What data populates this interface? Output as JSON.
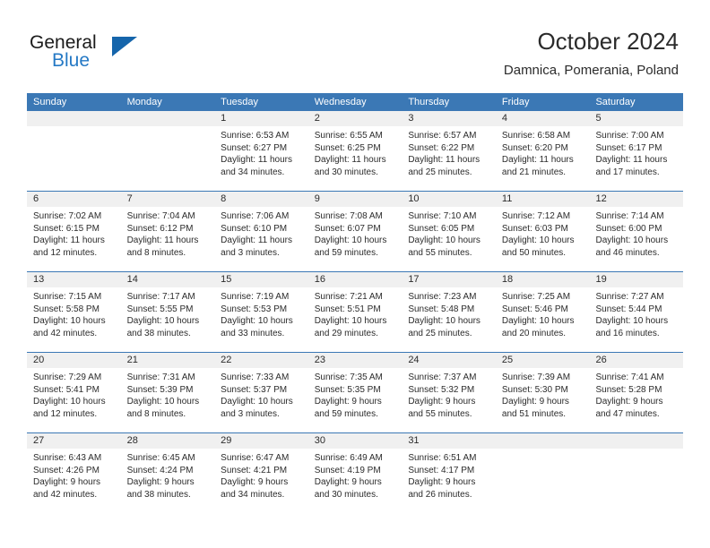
{
  "brand": {
    "name_part1": "General",
    "name_part2": "Blue",
    "triangle_color": "#1565ab",
    "blue_color": "#2579c5"
  },
  "header": {
    "title": "October 2024",
    "subtitle": "Damnica, Pomerania, Poland"
  },
  "theme": {
    "header_blue": "#3b78b5",
    "day_band_gray": "#f0f0f0",
    "text_color": "#2b2b2b"
  },
  "weekday_headers": [
    "Sunday",
    "Monday",
    "Tuesday",
    "Wednesday",
    "Thursday",
    "Friday",
    "Saturday"
  ],
  "weeks": [
    [
      {
        "day": "",
        "empty": true,
        "sunrise": "",
        "sunset": "",
        "daylight_line1": "",
        "daylight_line2": ""
      },
      {
        "day": "",
        "empty": true,
        "sunrise": "",
        "sunset": "",
        "daylight_line1": "",
        "daylight_line2": ""
      },
      {
        "day": "1",
        "sunrise": "Sunrise: 6:53 AM",
        "sunset": "Sunset: 6:27 PM",
        "daylight_line1": "Daylight: 11 hours",
        "daylight_line2": "and 34 minutes."
      },
      {
        "day": "2",
        "sunrise": "Sunrise: 6:55 AM",
        "sunset": "Sunset: 6:25 PM",
        "daylight_line1": "Daylight: 11 hours",
        "daylight_line2": "and 30 minutes."
      },
      {
        "day": "3",
        "sunrise": "Sunrise: 6:57 AM",
        "sunset": "Sunset: 6:22 PM",
        "daylight_line1": "Daylight: 11 hours",
        "daylight_line2": "and 25 minutes."
      },
      {
        "day": "4",
        "sunrise": "Sunrise: 6:58 AM",
        "sunset": "Sunset: 6:20 PM",
        "daylight_line1": "Daylight: 11 hours",
        "daylight_line2": "and 21 minutes."
      },
      {
        "day": "5",
        "sunrise": "Sunrise: 7:00 AM",
        "sunset": "Sunset: 6:17 PM",
        "daylight_line1": "Daylight: 11 hours",
        "daylight_line2": "and 17 minutes."
      }
    ],
    [
      {
        "day": "6",
        "sunrise": "Sunrise: 7:02 AM",
        "sunset": "Sunset: 6:15 PM",
        "daylight_line1": "Daylight: 11 hours",
        "daylight_line2": "and 12 minutes."
      },
      {
        "day": "7",
        "sunrise": "Sunrise: 7:04 AM",
        "sunset": "Sunset: 6:12 PM",
        "daylight_line1": "Daylight: 11 hours",
        "daylight_line2": "and 8 minutes."
      },
      {
        "day": "8",
        "sunrise": "Sunrise: 7:06 AM",
        "sunset": "Sunset: 6:10 PM",
        "daylight_line1": "Daylight: 11 hours",
        "daylight_line2": "and 3 minutes."
      },
      {
        "day": "9",
        "sunrise": "Sunrise: 7:08 AM",
        "sunset": "Sunset: 6:07 PM",
        "daylight_line1": "Daylight: 10 hours",
        "daylight_line2": "and 59 minutes."
      },
      {
        "day": "10",
        "sunrise": "Sunrise: 7:10 AM",
        "sunset": "Sunset: 6:05 PM",
        "daylight_line1": "Daylight: 10 hours",
        "daylight_line2": "and 55 minutes."
      },
      {
        "day": "11",
        "sunrise": "Sunrise: 7:12 AM",
        "sunset": "Sunset: 6:03 PM",
        "daylight_line1": "Daylight: 10 hours",
        "daylight_line2": "and 50 minutes."
      },
      {
        "day": "12",
        "sunrise": "Sunrise: 7:14 AM",
        "sunset": "Sunset: 6:00 PM",
        "daylight_line1": "Daylight: 10 hours",
        "daylight_line2": "and 46 minutes."
      }
    ],
    [
      {
        "day": "13",
        "sunrise": "Sunrise: 7:15 AM",
        "sunset": "Sunset: 5:58 PM",
        "daylight_line1": "Daylight: 10 hours",
        "daylight_line2": "and 42 minutes."
      },
      {
        "day": "14",
        "sunrise": "Sunrise: 7:17 AM",
        "sunset": "Sunset: 5:55 PM",
        "daylight_line1": "Daylight: 10 hours",
        "daylight_line2": "and 38 minutes."
      },
      {
        "day": "15",
        "sunrise": "Sunrise: 7:19 AM",
        "sunset": "Sunset: 5:53 PM",
        "daylight_line1": "Daylight: 10 hours",
        "daylight_line2": "and 33 minutes."
      },
      {
        "day": "16",
        "sunrise": "Sunrise: 7:21 AM",
        "sunset": "Sunset: 5:51 PM",
        "daylight_line1": "Daylight: 10 hours",
        "daylight_line2": "and 29 minutes."
      },
      {
        "day": "17",
        "sunrise": "Sunrise: 7:23 AM",
        "sunset": "Sunset: 5:48 PM",
        "daylight_line1": "Daylight: 10 hours",
        "daylight_line2": "and 25 minutes."
      },
      {
        "day": "18",
        "sunrise": "Sunrise: 7:25 AM",
        "sunset": "Sunset: 5:46 PM",
        "daylight_line1": "Daylight: 10 hours",
        "daylight_line2": "and 20 minutes."
      },
      {
        "day": "19",
        "sunrise": "Sunrise: 7:27 AM",
        "sunset": "Sunset: 5:44 PM",
        "daylight_line1": "Daylight: 10 hours",
        "daylight_line2": "and 16 minutes."
      }
    ],
    [
      {
        "day": "20",
        "sunrise": "Sunrise: 7:29 AM",
        "sunset": "Sunset: 5:41 PM",
        "daylight_line1": "Daylight: 10 hours",
        "daylight_line2": "and 12 minutes."
      },
      {
        "day": "21",
        "sunrise": "Sunrise: 7:31 AM",
        "sunset": "Sunset: 5:39 PM",
        "daylight_line1": "Daylight: 10 hours",
        "daylight_line2": "and 8 minutes."
      },
      {
        "day": "22",
        "sunrise": "Sunrise: 7:33 AM",
        "sunset": "Sunset: 5:37 PM",
        "daylight_line1": "Daylight: 10 hours",
        "daylight_line2": "and 3 minutes."
      },
      {
        "day": "23",
        "sunrise": "Sunrise: 7:35 AM",
        "sunset": "Sunset: 5:35 PM",
        "daylight_line1": "Daylight: 9 hours",
        "daylight_line2": "and 59 minutes."
      },
      {
        "day": "24",
        "sunrise": "Sunrise: 7:37 AM",
        "sunset": "Sunset: 5:32 PM",
        "daylight_line1": "Daylight: 9 hours",
        "daylight_line2": "and 55 minutes."
      },
      {
        "day": "25",
        "sunrise": "Sunrise: 7:39 AM",
        "sunset": "Sunset: 5:30 PM",
        "daylight_line1": "Daylight: 9 hours",
        "daylight_line2": "and 51 minutes."
      },
      {
        "day": "26",
        "sunrise": "Sunrise: 7:41 AM",
        "sunset": "Sunset: 5:28 PM",
        "daylight_line1": "Daylight: 9 hours",
        "daylight_line2": "and 47 minutes."
      }
    ],
    [
      {
        "day": "27",
        "sunrise": "Sunrise: 6:43 AM",
        "sunset": "Sunset: 4:26 PM",
        "daylight_line1": "Daylight: 9 hours",
        "daylight_line2": "and 42 minutes."
      },
      {
        "day": "28",
        "sunrise": "Sunrise: 6:45 AM",
        "sunset": "Sunset: 4:24 PM",
        "daylight_line1": "Daylight: 9 hours",
        "daylight_line2": "and 38 minutes."
      },
      {
        "day": "29",
        "sunrise": "Sunrise: 6:47 AM",
        "sunset": "Sunset: 4:21 PM",
        "daylight_line1": "Daylight: 9 hours",
        "daylight_line2": "and 34 minutes."
      },
      {
        "day": "30",
        "sunrise": "Sunrise: 6:49 AM",
        "sunset": "Sunset: 4:19 PM",
        "daylight_line1": "Daylight: 9 hours",
        "daylight_line2": "and 30 minutes."
      },
      {
        "day": "31",
        "sunrise": "Sunrise: 6:51 AM",
        "sunset": "Sunset: 4:17 PM",
        "daylight_line1": "Daylight: 9 hours",
        "daylight_line2": "and 26 minutes."
      },
      {
        "day": "",
        "empty": true,
        "sunrise": "",
        "sunset": "",
        "daylight_line1": "",
        "daylight_line2": ""
      },
      {
        "day": "",
        "empty": true,
        "sunrise": "",
        "sunset": "",
        "daylight_line1": "",
        "daylight_line2": ""
      }
    ]
  ]
}
